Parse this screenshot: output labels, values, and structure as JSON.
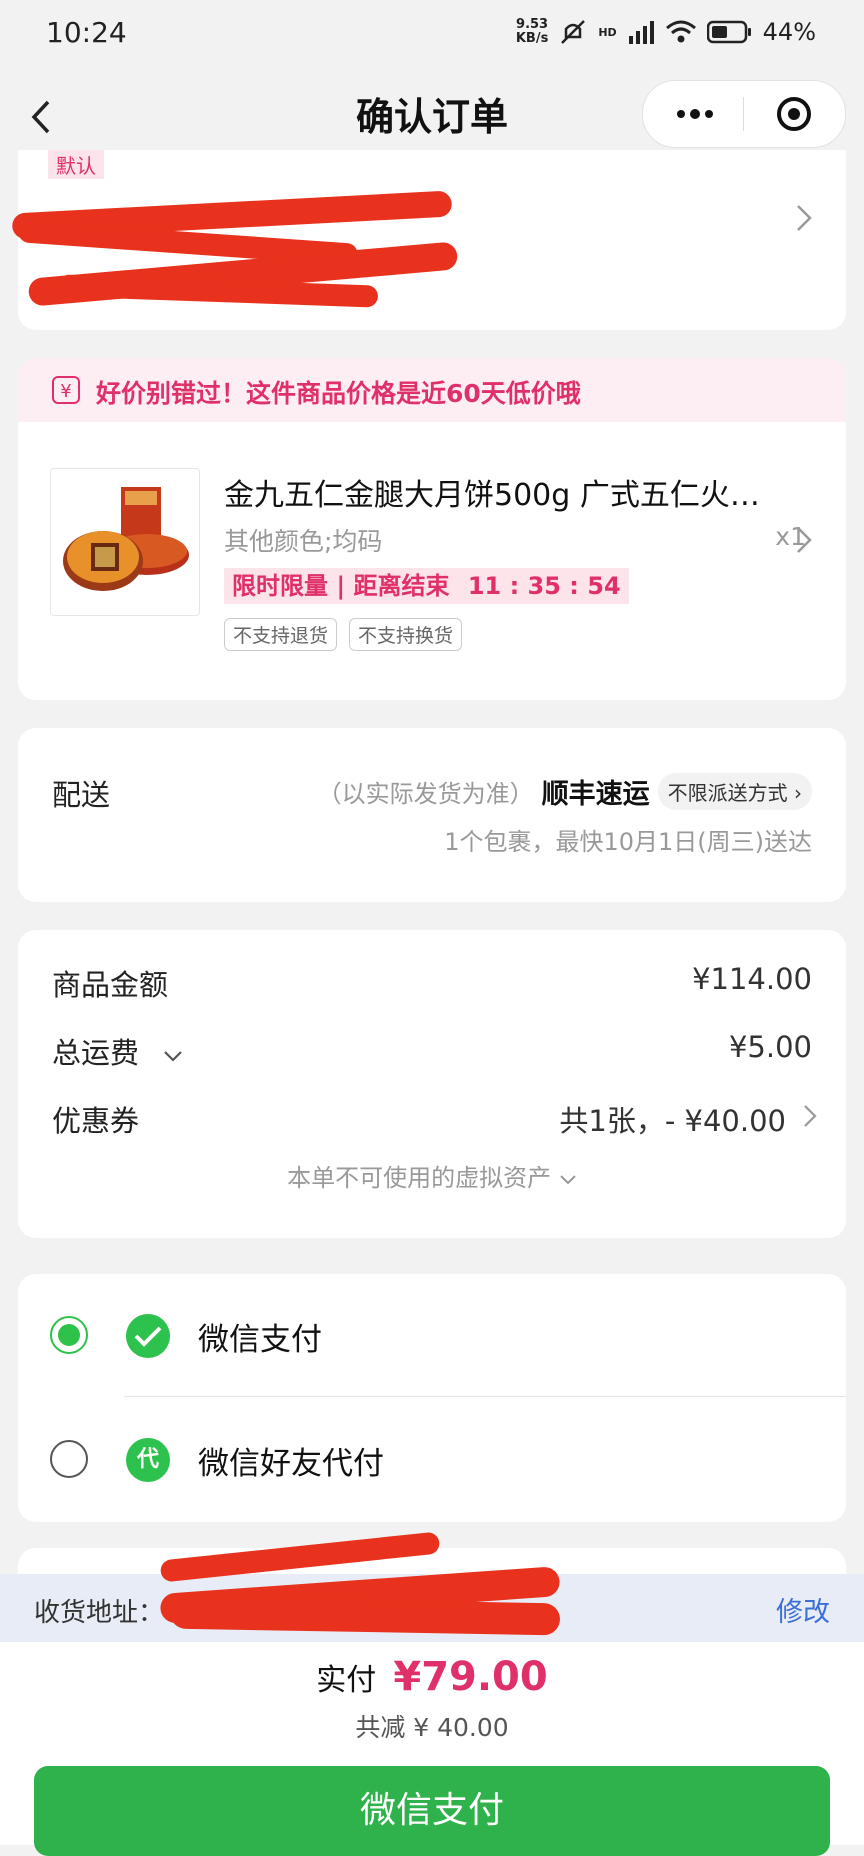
{
  "status_bar": {
    "time": "10:24",
    "net_speed_value": "9.53",
    "net_speed_unit": "KB/s",
    "network": "HD",
    "battery": "44%"
  },
  "nav": {
    "title": "确认订单"
  },
  "address_card": {
    "tag": "默认"
  },
  "product": {
    "promo_text": "好价别错过！这件商品价格是近60天低价哦",
    "name": "金九五仁金腿大月饼500g 广式五仁火…",
    "spec": "其他颜色;均码",
    "qty": "x1",
    "limit_label": "限时限量 | 距离结束",
    "countdown": "11 : 35 : 54",
    "tags": [
      "不支持退货",
      "不支持换货"
    ]
  },
  "delivery": {
    "label": "配送",
    "note": "（以实际发货为准）",
    "carrier": "顺丰速运",
    "method": "不限派送方式",
    "eta": "1个包裹，最快10月1日(周三)送达"
  },
  "price": {
    "goods_label": "商品金额",
    "goods_value": "¥114.00",
    "shipping_label": "总运费",
    "shipping_value": "¥5.00",
    "coupon_label": "优惠券",
    "coupon_value": "共1张，- ¥40.00",
    "virtual_assets": "本单不可使用的虚拟资产"
  },
  "payment": {
    "options": [
      {
        "label": "微信支付",
        "selected": true
      },
      {
        "label": "微信好友代付",
        "selected": false
      }
    ],
    "friend_icon_text": "代"
  },
  "bottom": {
    "address_label": "收货地址：",
    "edit_label": "修改",
    "total_label": "实付",
    "total_value": "¥79.00",
    "discount": "共减 ¥ 40.00",
    "pay_button": "微信支付"
  },
  "colors": {
    "accent_pink": "#e0306a",
    "wechat_green": "#2fb24b",
    "redaction": "#e8321d"
  }
}
